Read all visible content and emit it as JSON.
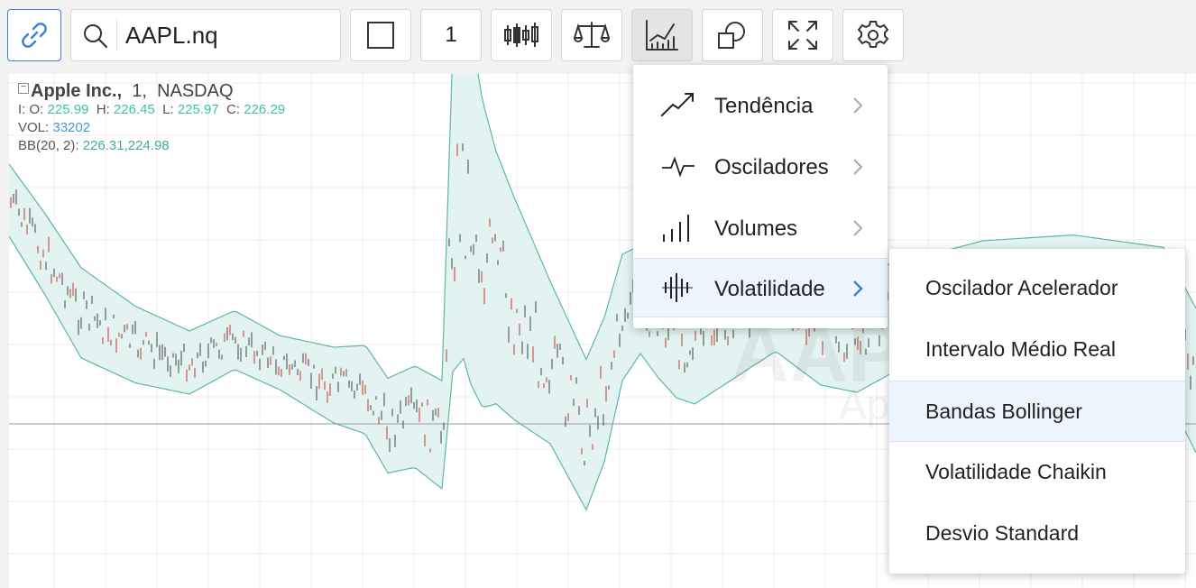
{
  "toolbar": {
    "symbol_value": "AAPL.nq",
    "interval_label": "1",
    "buttons": [
      {
        "name": "link-icon"
      },
      {
        "name": "search-icon"
      },
      {
        "name": "square-icon"
      },
      {
        "name": "candlestick-icon"
      },
      {
        "name": "balance-scale-icon"
      },
      {
        "name": "indicators-icon"
      },
      {
        "name": "shapes-icon"
      },
      {
        "name": "fullscreen-icon"
      },
      {
        "name": "gear-icon"
      }
    ]
  },
  "legend": {
    "company": "Apple Inc.,",
    "interval": "1,",
    "exchange": "NASDAQ",
    "o_label": "I: O:",
    "o_value": "225.99",
    "h_label": "H:",
    "h_value": "226.45",
    "l_label": "L:",
    "l_value": "225.97",
    "c_label": "C:",
    "c_value": "226.29",
    "vol_label": "VOL:",
    "vol_value": "33202",
    "bb_label": "BB(20, 2):",
    "bb_value": "226.31,224.98"
  },
  "watermark": {
    "symbol": "AAPL",
    "name": "Apple Inc."
  },
  "indicator_menu": {
    "items": [
      {
        "label": "Tendência",
        "icon": "trend-icon"
      },
      {
        "label": "Osciladores",
        "icon": "oscillator-icon"
      },
      {
        "label": "Volumes",
        "icon": "volume-bars-icon"
      },
      {
        "label": "Volatilidade",
        "icon": "volatility-icon",
        "selected": true
      }
    ]
  },
  "volatility_submenu": {
    "items": [
      {
        "label": "Oscilador Acelerador"
      },
      {
        "label": "Intervalo Médio Real"
      },
      {
        "label": "Bandas Bollinger",
        "highlighted": true
      },
      {
        "label": "Volatilidade Chaikin"
      },
      {
        "label": "Desvio Standard"
      }
    ]
  },
  "colors": {
    "accent": "#3d7fd6",
    "up": "#3cc49e",
    "band_fill": "#e2f3f1",
    "band_line": "#5fb5ab",
    "bar": "#444444",
    "bar_red": "#c0392b"
  }
}
